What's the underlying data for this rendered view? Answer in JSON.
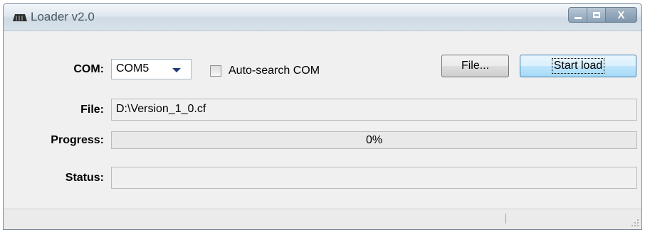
{
  "window": {
    "title": "Loader v2.0",
    "icon": "loader-app-icon",
    "controls": {
      "minimize_icon": "minimize-icon",
      "maximize_icon": "maximize-icon",
      "close_label": "X"
    }
  },
  "com": {
    "label": "COM:",
    "selected": "COM5",
    "dropdown_icon": "chevron-down-icon",
    "auto_search_label": "Auto-search COM",
    "auto_search_checked": false
  },
  "buttons": {
    "file_label": "File...",
    "start_label": "Start load"
  },
  "file": {
    "label": "File:",
    "value": "D:\\Version_1_0.cf"
  },
  "progress": {
    "label": "Progress:",
    "value_text": "0%",
    "fraction": 0.0
  },
  "status": {
    "label": "Status:",
    "value": ""
  },
  "colors": {
    "accent": "#3c7fb1",
    "progress_fill": "#3ab33a",
    "dropdown_arrow": "#1c3a78"
  }
}
